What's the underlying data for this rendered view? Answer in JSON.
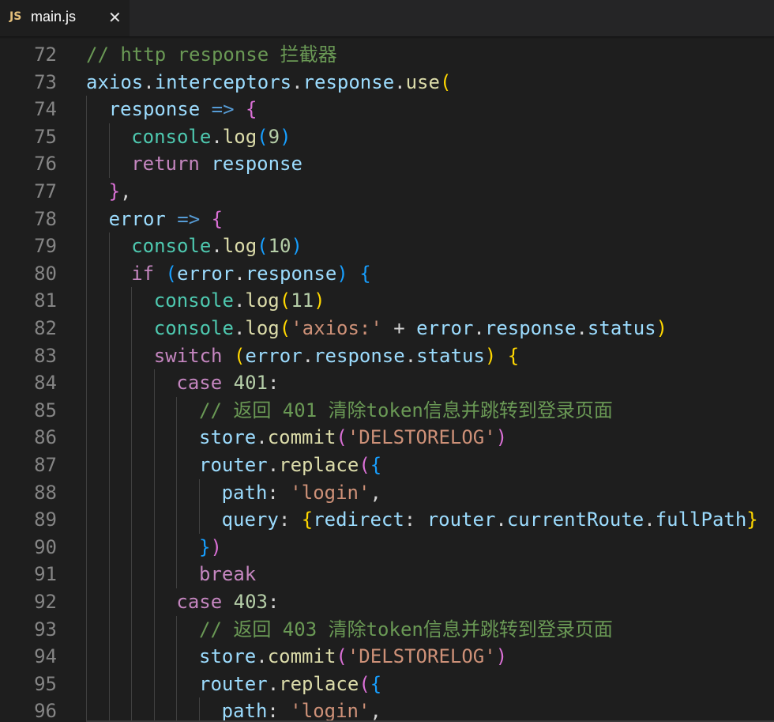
{
  "tab": {
    "icon_label": "JS",
    "file_name": "main.js",
    "close_glyph": "✕"
  },
  "lines": [
    {
      "n": "72",
      "indent": 0,
      "tokens": [
        [
          "cm",
          "// http response 拦截器"
        ]
      ]
    },
    {
      "n": "73",
      "indent": 0,
      "tokens": [
        [
          "id",
          "axios"
        ],
        [
          "op",
          "."
        ],
        [
          "id",
          "interceptors"
        ],
        [
          "op",
          "."
        ],
        [
          "id",
          "response"
        ],
        [
          "op",
          "."
        ],
        [
          "fn",
          "use"
        ],
        [
          "b1",
          "("
        ]
      ]
    },
    {
      "n": "74",
      "indent": 1,
      "tokens": [
        [
          "id",
          "response"
        ],
        [
          "op",
          " "
        ],
        [
          "arrow",
          "=>"
        ],
        [
          "op",
          " "
        ],
        [
          "b2",
          "{"
        ]
      ]
    },
    {
      "n": "75",
      "indent": 2,
      "tokens": [
        [
          "cls",
          "console"
        ],
        [
          "op",
          "."
        ],
        [
          "fn",
          "log"
        ],
        [
          "b3",
          "("
        ],
        [
          "num",
          "9"
        ],
        [
          "b3",
          ")"
        ]
      ]
    },
    {
      "n": "76",
      "indent": 2,
      "tokens": [
        [
          "kw",
          "return"
        ],
        [
          "op",
          " "
        ],
        [
          "id",
          "response"
        ]
      ]
    },
    {
      "n": "77",
      "indent": 1,
      "tokens": [
        [
          "b2",
          "}"
        ],
        [
          "op",
          ","
        ]
      ]
    },
    {
      "n": "78",
      "indent": 1,
      "tokens": [
        [
          "id",
          "error"
        ],
        [
          "op",
          " "
        ],
        [
          "arrow",
          "=>"
        ],
        [
          "op",
          " "
        ],
        [
          "b2",
          "{"
        ]
      ]
    },
    {
      "n": "79",
      "indent": 2,
      "tokens": [
        [
          "cls",
          "console"
        ],
        [
          "op",
          "."
        ],
        [
          "fn",
          "log"
        ],
        [
          "b3",
          "("
        ],
        [
          "num",
          "10"
        ],
        [
          "b3",
          ")"
        ]
      ]
    },
    {
      "n": "80",
      "indent": 2,
      "tokens": [
        [
          "kw",
          "if"
        ],
        [
          "op",
          " "
        ],
        [
          "b3",
          "("
        ],
        [
          "id",
          "error"
        ],
        [
          "op",
          "."
        ],
        [
          "id",
          "response"
        ],
        [
          "b3",
          ")"
        ],
        [
          "op",
          " "
        ],
        [
          "b3",
          "{"
        ]
      ]
    },
    {
      "n": "81",
      "indent": 3,
      "tokens": [
        [
          "cls",
          "console"
        ],
        [
          "op",
          "."
        ],
        [
          "fn",
          "log"
        ],
        [
          "b1",
          "("
        ],
        [
          "num",
          "11"
        ],
        [
          "b1",
          ")"
        ]
      ]
    },
    {
      "n": "82",
      "indent": 3,
      "tokens": [
        [
          "cls",
          "console"
        ],
        [
          "op",
          "."
        ],
        [
          "fn",
          "log"
        ],
        [
          "b1",
          "("
        ],
        [
          "str",
          "'axios:'"
        ],
        [
          "op",
          " + "
        ],
        [
          "id",
          "error"
        ],
        [
          "op",
          "."
        ],
        [
          "id",
          "response"
        ],
        [
          "op",
          "."
        ],
        [
          "id",
          "status"
        ],
        [
          "b1",
          ")"
        ]
      ]
    },
    {
      "n": "83",
      "indent": 3,
      "tokens": [
        [
          "kw",
          "switch"
        ],
        [
          "op",
          " "
        ],
        [
          "b1",
          "("
        ],
        [
          "id",
          "error"
        ],
        [
          "op",
          "."
        ],
        [
          "id",
          "response"
        ],
        [
          "op",
          "."
        ],
        [
          "id",
          "status"
        ],
        [
          "b1",
          ")"
        ],
        [
          "op",
          " "
        ],
        [
          "b1",
          "{"
        ]
      ]
    },
    {
      "n": "84",
      "indent": 4,
      "tokens": [
        [
          "kw",
          "case"
        ],
        [
          "op",
          " "
        ],
        [
          "num",
          "401"
        ],
        [
          "op",
          ":"
        ]
      ]
    },
    {
      "n": "85",
      "indent": 5,
      "tokens": [
        [
          "cm",
          "// 返回 401 清除token信息并跳转到登录页面"
        ]
      ]
    },
    {
      "n": "86",
      "indent": 5,
      "tokens": [
        [
          "id",
          "store"
        ],
        [
          "op",
          "."
        ],
        [
          "fn",
          "commit"
        ],
        [
          "b2",
          "("
        ],
        [
          "str",
          "'DELSTORELOG'"
        ],
        [
          "b2",
          ")"
        ]
      ]
    },
    {
      "n": "87",
      "indent": 5,
      "tokens": [
        [
          "id",
          "router"
        ],
        [
          "op",
          "."
        ],
        [
          "fn",
          "replace"
        ],
        [
          "b2",
          "("
        ],
        [
          "b3",
          "{"
        ]
      ]
    },
    {
      "n": "88",
      "indent": 6,
      "tokens": [
        [
          "id",
          "path"
        ],
        [
          "op",
          ": "
        ],
        [
          "str",
          "'login'"
        ],
        [
          "op",
          ","
        ]
      ]
    },
    {
      "n": "89",
      "indent": 6,
      "tokens": [
        [
          "id",
          "query"
        ],
        [
          "op",
          ": "
        ],
        [
          "b1",
          "{"
        ],
        [
          "id",
          "redirect"
        ],
        [
          "op",
          ": "
        ],
        [
          "id",
          "router"
        ],
        [
          "op",
          "."
        ],
        [
          "id",
          "currentRoute"
        ],
        [
          "op",
          "."
        ],
        [
          "id",
          "fullPath"
        ],
        [
          "b1",
          "}"
        ]
      ]
    },
    {
      "n": "90",
      "indent": 5,
      "tokens": [
        [
          "b3",
          "}"
        ],
        [
          "b2",
          ")"
        ]
      ]
    },
    {
      "n": "91",
      "indent": 5,
      "tokens": [
        [
          "kw",
          "break"
        ]
      ]
    },
    {
      "n": "92",
      "indent": 4,
      "tokens": [
        [
          "kw",
          "case"
        ],
        [
          "op",
          " "
        ],
        [
          "num",
          "403"
        ],
        [
          "op",
          ":"
        ]
      ]
    },
    {
      "n": "93",
      "indent": 5,
      "tokens": [
        [
          "cm",
          "// 返回 403 清除token信息并跳转到登录页面"
        ]
      ]
    },
    {
      "n": "94",
      "indent": 5,
      "tokens": [
        [
          "id",
          "store"
        ],
        [
          "op",
          "."
        ],
        [
          "fn",
          "commit"
        ],
        [
          "b2",
          "("
        ],
        [
          "str",
          "'DELSTORELOG'"
        ],
        [
          "b2",
          ")"
        ]
      ]
    },
    {
      "n": "95",
      "indent": 5,
      "tokens": [
        [
          "id",
          "router"
        ],
        [
          "op",
          "."
        ],
        [
          "fn",
          "replace"
        ],
        [
          "b2",
          "("
        ],
        [
          "b3",
          "{"
        ]
      ]
    },
    {
      "n": "96",
      "indent": 6,
      "tokens": [
        [
          "id",
          "path"
        ],
        [
          "op",
          ": "
        ],
        [
          "str",
          "'login'"
        ],
        [
          "op",
          ","
        ]
      ]
    }
  ]
}
